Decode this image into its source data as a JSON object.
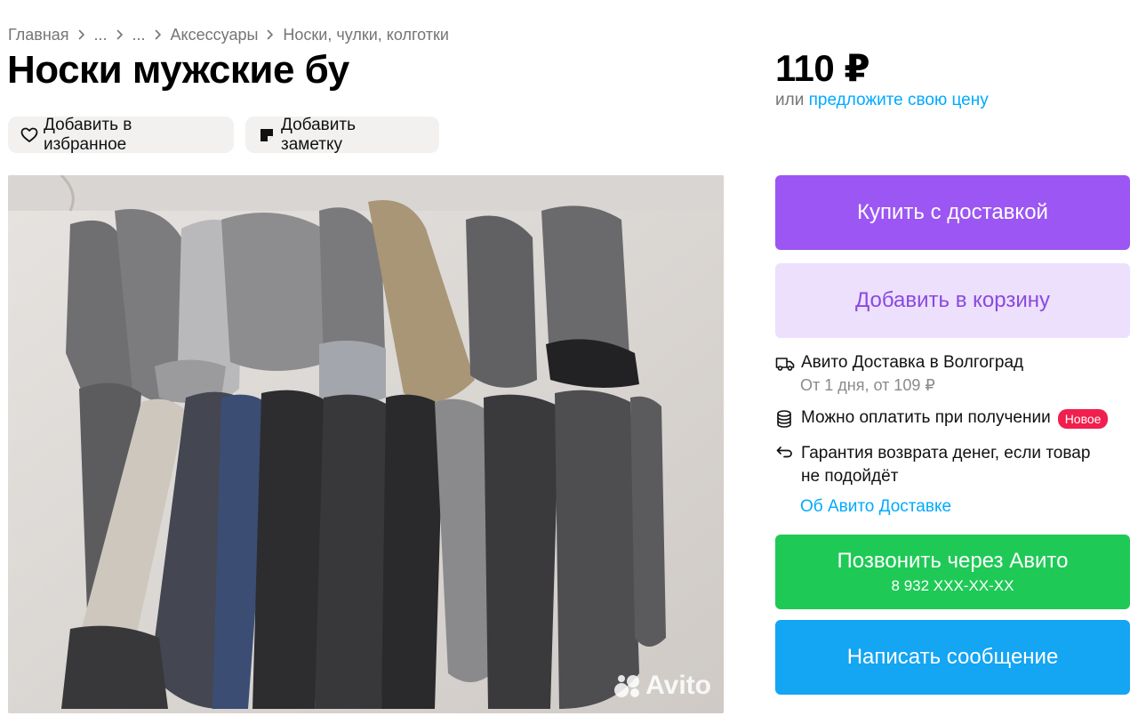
{
  "breadcrumbs": {
    "items": [
      "Главная",
      "...",
      "...",
      "Аксессуары",
      "Носки, чулки, колготки"
    ]
  },
  "listing": {
    "title": "Носки мужские бу",
    "price": "110 ₽",
    "offer_prefix": "или",
    "offer_link": "предложите свою цену"
  },
  "actions": {
    "favorite_label": "Добавить в избранное",
    "note_label": "Добавить заметку"
  },
  "photo": {
    "watermark": "Avito"
  },
  "buttons": {
    "buy_label": "Купить с доставкой",
    "cart_label": "Добавить в корзину",
    "call_label": "Позвонить через Авито",
    "call_phone": "8 932 XXX-XX-XX",
    "message_label": "Написать сообщение"
  },
  "features": {
    "delivery_title": "Авито Доставка в Волгоград",
    "delivery_sub": "От 1 дня, от 109 ₽",
    "payment_text": "Можно оплатить при получении",
    "payment_badge": "Новое",
    "guarantee_text": "Гарантия возврата денег, если товар не подойдёт",
    "about_link": "Об Авито Доставке"
  },
  "colors": {
    "buy": "#9c56f3",
    "cart_bg": "#ece0fd",
    "call": "#1fc956",
    "message": "#14a5f3",
    "link": "#00aaff",
    "badge": "#f01f4d"
  }
}
